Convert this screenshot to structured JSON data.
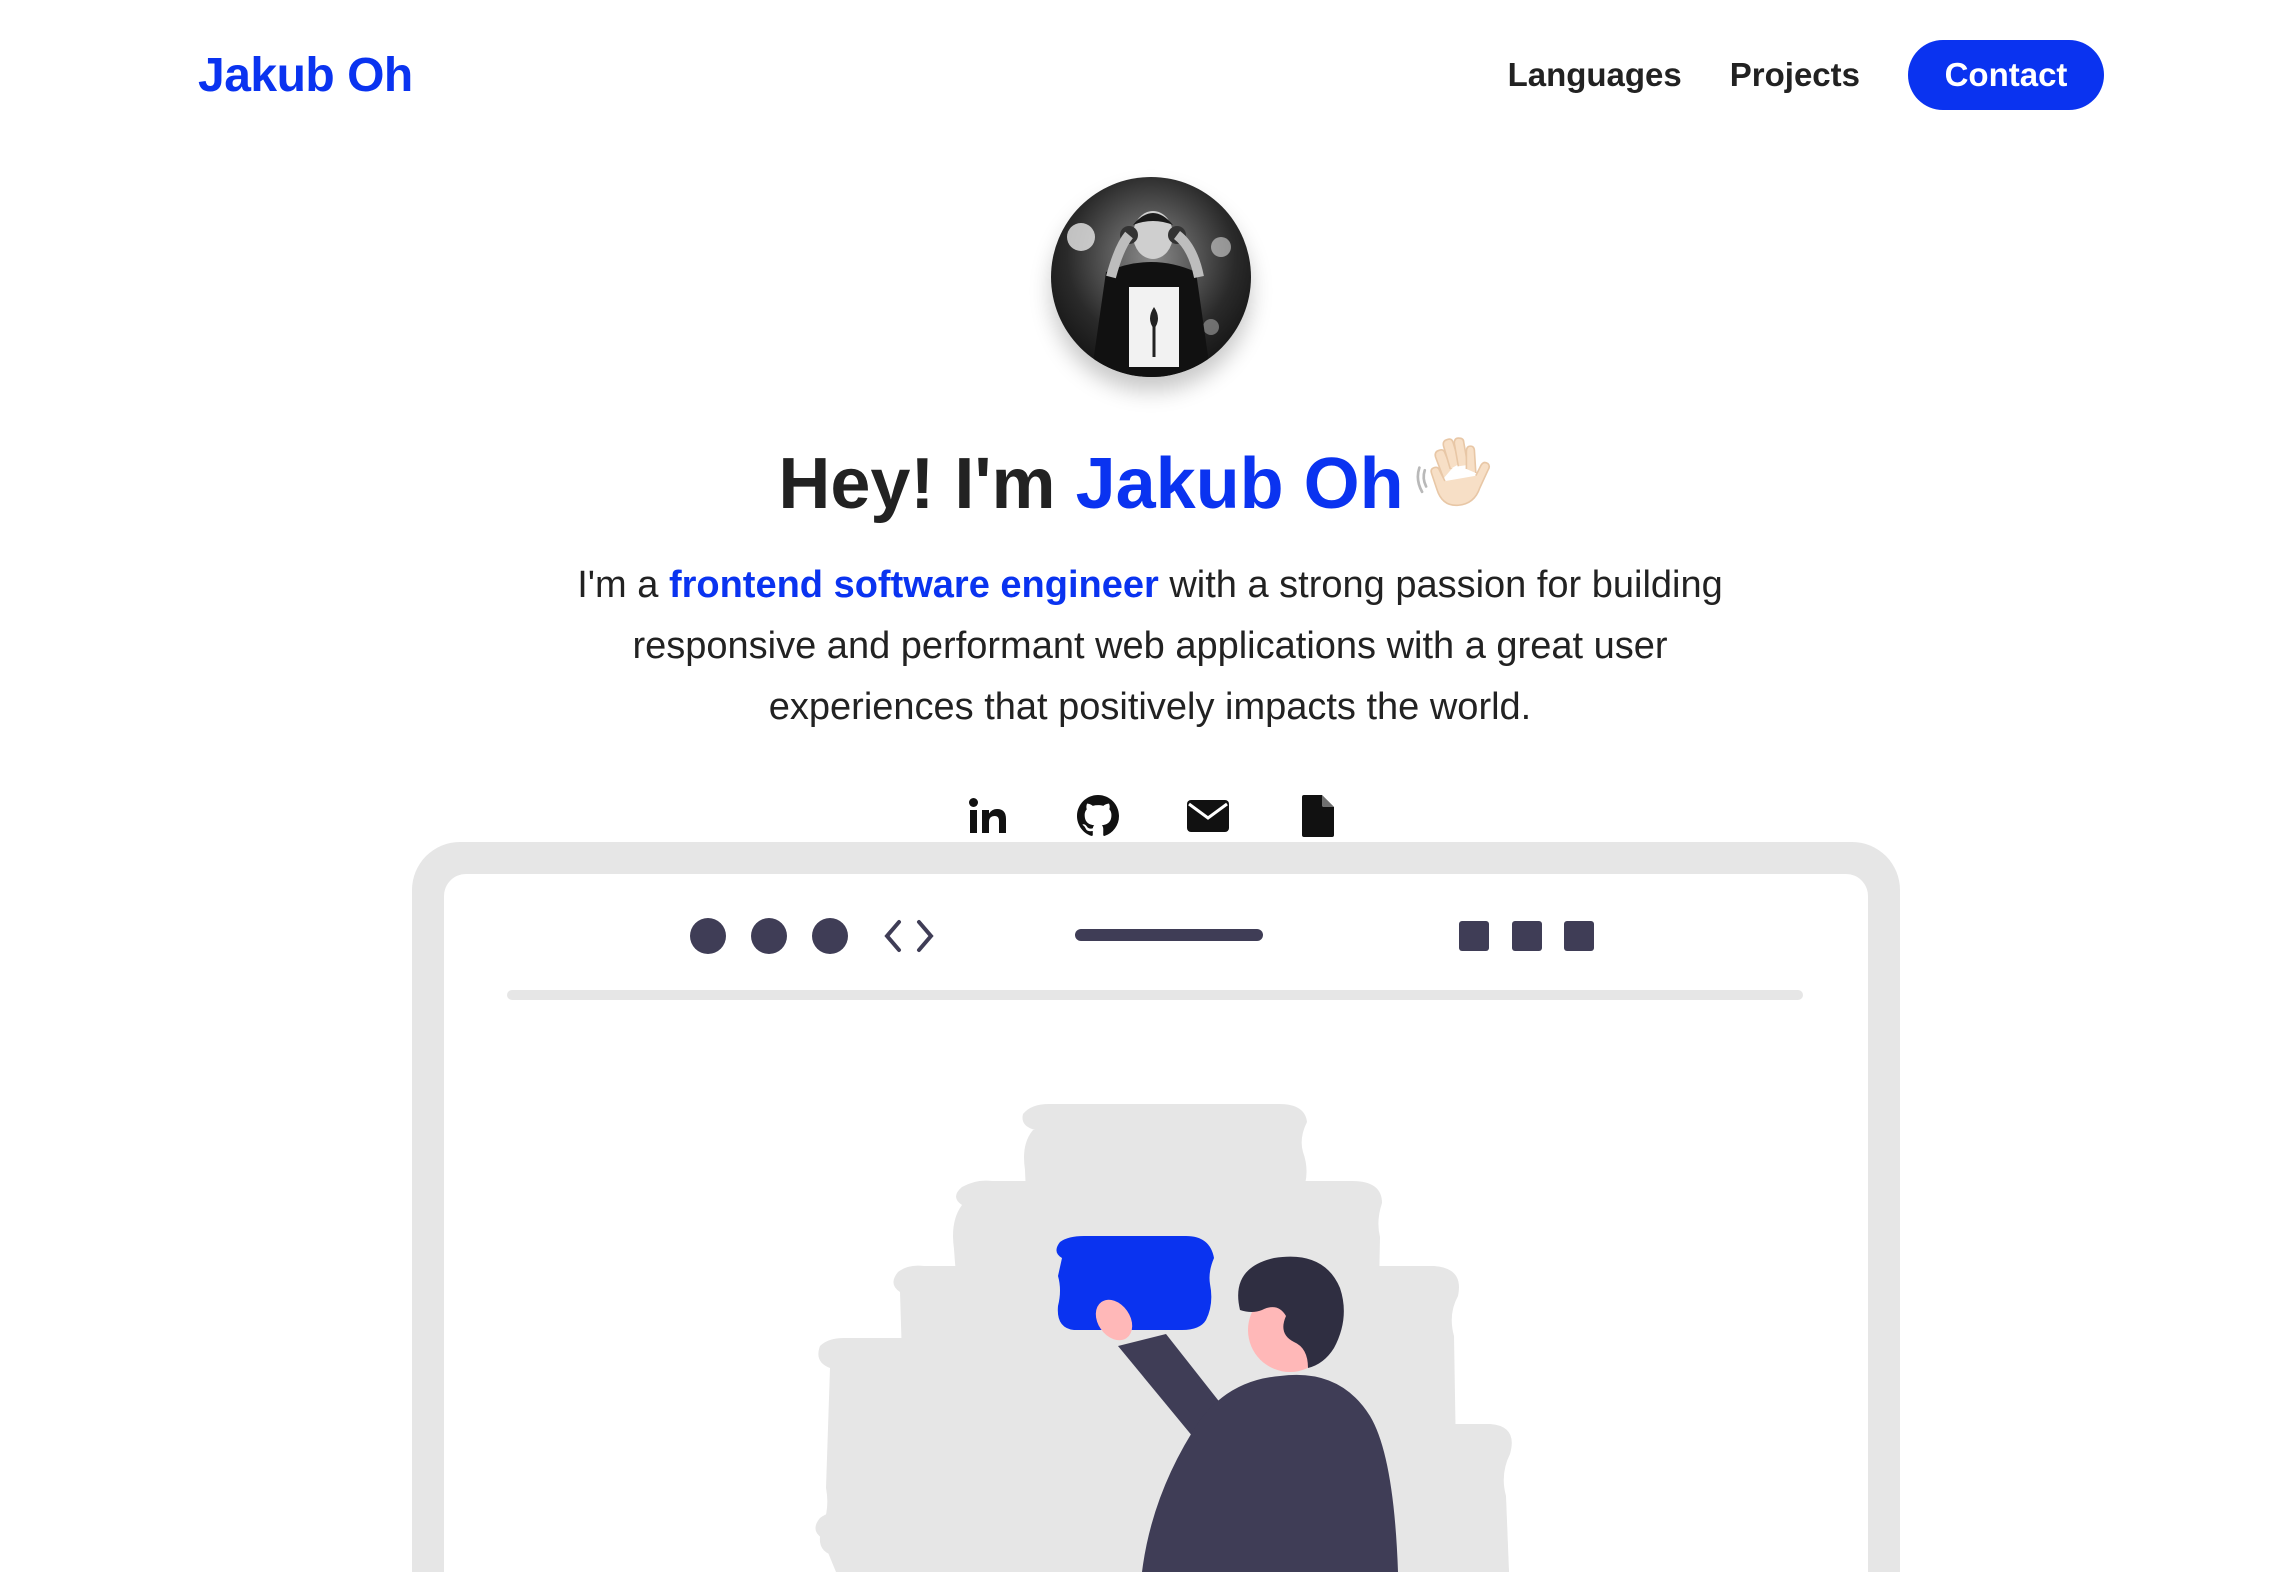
{
  "header": {
    "logo": "Jakub Oh",
    "nav": {
      "languages": "Languages",
      "projects": "Projects",
      "contact": "Contact"
    }
  },
  "hero": {
    "title_prefix": "Hey! I'm ",
    "title_name": "Jakub Oh",
    "wave_emoji": "👋",
    "text_prefix": "I'm a ",
    "text_highlight": "frontend software engineer",
    "text_suffix": " with a strong passion for building responsive and performant web applications with a great user experiences that positively impacts the world."
  },
  "socials": [
    "linkedin-icon",
    "github-icon",
    "email-icon",
    "document-icon"
  ],
  "colors": {
    "accent": "#0a33f0",
    "text": "#222222",
    "illustration_dark": "#3f3d56",
    "illustration_light": "#e6e6e6",
    "skin": "#ffb8b8"
  }
}
